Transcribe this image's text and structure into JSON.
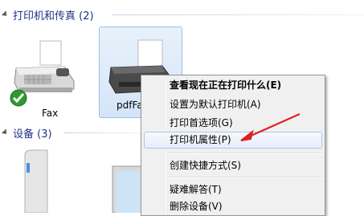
{
  "sections": {
    "printers_title": "打印机和传真 (2)",
    "devices_title": "设备 (3)"
  },
  "devices": {
    "fax_label": "Fax",
    "pdf_label": "pdfFa"
  },
  "context_menu": {
    "items": [
      "查看现在正在打印什么(E)",
      "设置为默认打印机(A)",
      "打印首选项(G)",
      "打印机属性(P)",
      "创建快捷方式(S)",
      "疑难解答(T)",
      "删除设备(V)"
    ]
  },
  "colors": {
    "annotation_arrow": "#e02020",
    "section_title": "#1e3287",
    "highlight_border": "#a8c8ec"
  }
}
